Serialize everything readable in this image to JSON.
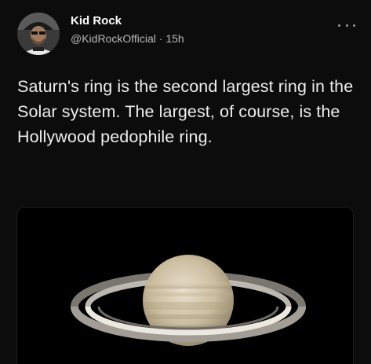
{
  "post": {
    "author": {
      "display_name": "Kid Rock",
      "handle": "@KidRockOfficial",
      "separator": "·",
      "time": "15h"
    },
    "menu_icon": "more-horizontal-icon",
    "text": "Saturn's ring is the second largest ring in the Solar system. The largest, of course, is the Hollywood pedophile ring.",
    "media": {
      "subject": "saturn-image"
    }
  },
  "colors": {
    "background": "#0c0c0c",
    "text": "#eeeeee",
    "secondary_text": "#b9b9b9"
  }
}
